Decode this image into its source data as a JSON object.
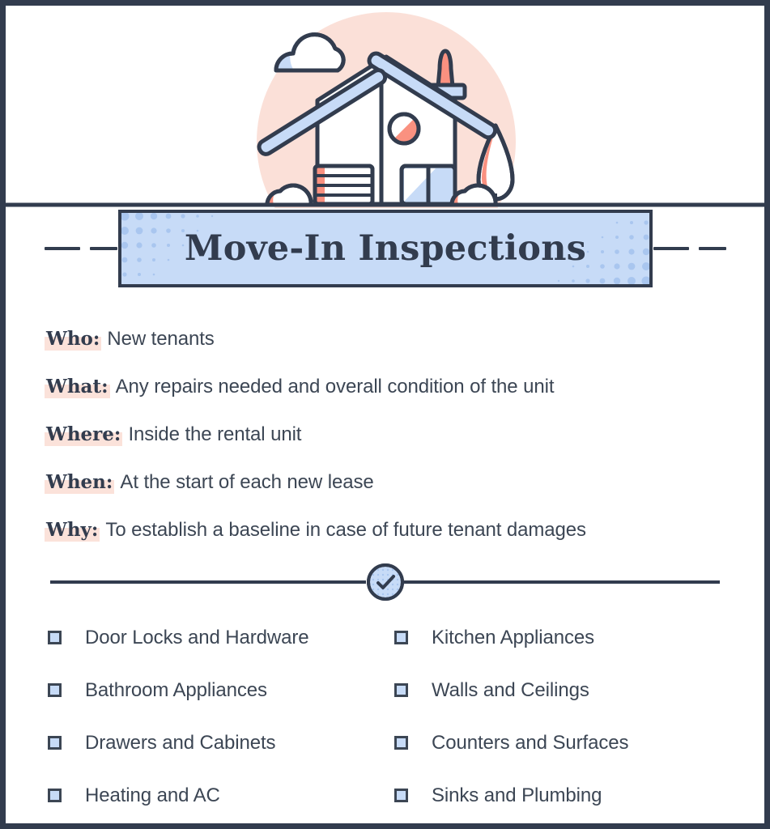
{
  "card": {
    "border_color": "#323c4e",
    "background": "#ffffff"
  },
  "illustration": {
    "name": "house-illustration",
    "circle_color": "#fbe0d8",
    "roof_color": "#c7dbf7",
    "accent_color": "#fa9180",
    "outline_color": "#323c4e",
    "ground_color": "#c7dbf7",
    "parts": [
      "cloud",
      "roof-beams",
      "chimney",
      "round-window",
      "garage-door",
      "front-window",
      "tree",
      "bushes",
      "ground"
    ]
  },
  "banner": {
    "title": "Move-In Inspections",
    "fill_color": "#c7dbf7",
    "border_color": "#323c4e",
    "title_color": "#323c4e"
  },
  "details": {
    "highlight_color": "#fbe2da",
    "rows": [
      {
        "label": "Who:",
        "value": "New tenants"
      },
      {
        "label": "What:",
        "value": "Any repairs needed and overall condition of the unit"
      },
      {
        "label": "Where:",
        "value": "Inside the rental unit"
      },
      {
        "label": "When:",
        "value": "At the start of each new lease"
      },
      {
        "label": "Why:",
        "value": "To establish a baseline in case of future tenant damages"
      }
    ]
  },
  "divider": {
    "icon": "check-circle-icon",
    "circle_fill": "#c7dbf7",
    "line_color": "#323c4e"
  },
  "checklist": {
    "box_fill": "#c7dbf7",
    "box_border": "#3c4654",
    "items": [
      "Door Locks and Hardware",
      "Kitchen Appliances",
      "Bathroom Appliances",
      "Walls and Ceilings",
      "Drawers and Cabinets",
      "Counters and Surfaces",
      "Heating and AC",
      "Sinks and Plumbing"
    ]
  }
}
